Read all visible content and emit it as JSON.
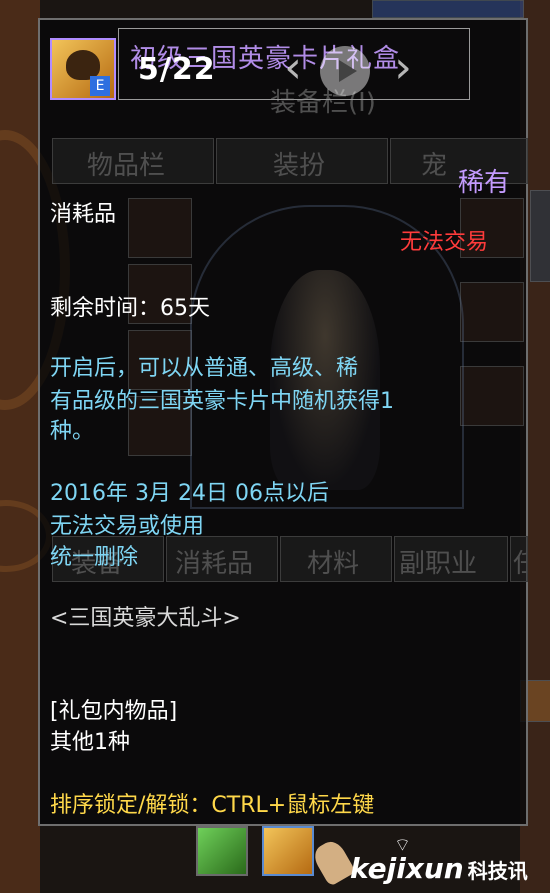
{
  "gallery": {
    "page_counter": "5/22",
    "prev_glyph": "‹",
    "next_glyph": "›"
  },
  "item": {
    "title": "初级三国英豪卡片礼盒",
    "rarity": "稀有",
    "category": "消耗品",
    "trade_status": "无法交易",
    "time_left": "剩余时间：65天",
    "description_lines": [
      "    开启后，可以从普通、高级、稀",
      "有品级的三国英豪卡片中随机获得1",
      "种。"
    ],
    "expiry_lines": [
      "2016年 3月 24日 06点以后",
      "无法交易或使用",
      "统一删除"
    ],
    "event_name": "<三国英豪大乱斗>",
    "contents_header": "[礼包内物品]",
    "contents_count": "其他1种",
    "sort_hint": "排序锁定/解锁：CTRL+鼠标左键"
  },
  "background_ui": {
    "equipment_header": "装备栏(I)",
    "top_tabs": [
      "物品栏",
      "装扮",
      "宠"
    ],
    "bottom_tabs": [
      "装备",
      "消耗品",
      "材料",
      "副职业",
      "任"
    ],
    "side_label": "宠"
  },
  "watermark": {
    "brand": "kejixun",
    "cn": "科技讯"
  },
  "colors": {
    "rare_purple": "#c49bff",
    "trade_red": "#ff3b3b",
    "desc_cyan": "#7fd6f4",
    "hint_yellow": "#ffd84a"
  },
  "icons": [
    "gift-box-icon",
    "play-icon",
    "prev-arrow-icon",
    "next-arrow-icon",
    "wifi-icon",
    "hand-cursor-icon"
  ]
}
